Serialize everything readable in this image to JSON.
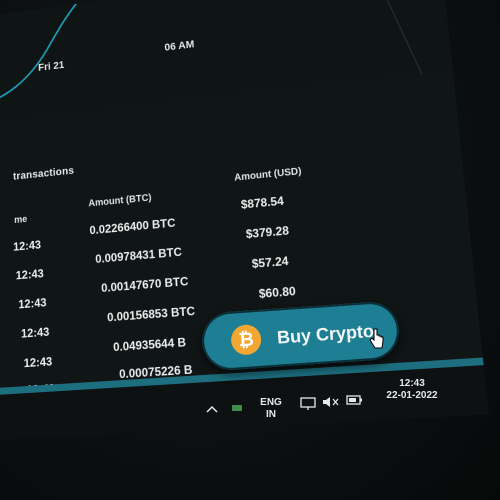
{
  "chart": {
    "date_labels": [
      "Fri 21",
      "06 AM"
    ],
    "line_color": "#1d9cb3"
  },
  "transactions": {
    "title": "transactions",
    "headers": [
      "me",
      "Amount (BTC)",
      "Amount (USD)"
    ],
    "rows": [
      {
        "time": "12:43",
        "btc": "0.02266400 BTC",
        "usd": "$878.54"
      },
      {
        "time": "12:43",
        "btc": "0.00978431 BTC",
        "usd": "$379.28"
      },
      {
        "time": "12:43",
        "btc": "0.00147670 BTC",
        "usd": "$57.24"
      },
      {
        "time": "12:43",
        "btc": "0.00156853 BTC",
        "usd": "$60.80"
      },
      {
        "time": "12:43",
        "btc": "0.04935644 B",
        "usd": ""
      },
      {
        "time": "12:43",
        "btc": "0.00075226 B",
        "usd": ""
      }
    ]
  },
  "buy_button": {
    "label": "Buy Crypto",
    "coin_symbol": "₿",
    "color": "#1e7f94",
    "coin_color": "#f3a632"
  },
  "taskbar": {
    "language_line1": "ENG",
    "language_line2": "IN",
    "time": "12:43",
    "date": "22-01-2022",
    "accent_color": "#1d6f80"
  },
  "icons": [
    "chevron-up-icon",
    "network-icon",
    "display-icon",
    "speaker-muted-icon",
    "battery-icon",
    "bitcoin-icon",
    "pointer-cursor-icon"
  ]
}
